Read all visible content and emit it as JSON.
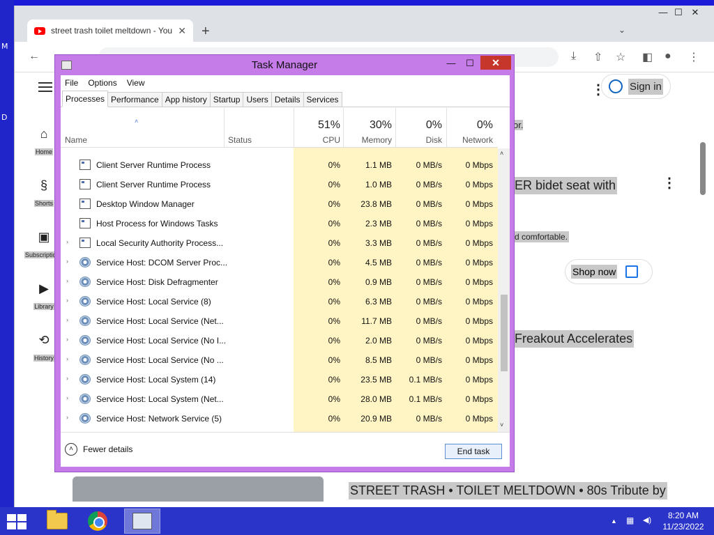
{
  "desktop": {
    "letters": [
      "M",
      "D"
    ]
  },
  "browser": {
    "tab_title": "street trash toilet meltdown - You",
    "tab_close": "✕",
    "new_tab": "+",
    "tab_chevron": "⌄",
    "window_min": "—",
    "window_max": "☐",
    "window_close": "✕",
    "back_icon": "←",
    "download_icon": "⤓",
    "share_icon": "⇧",
    "star_icon": "☆",
    "sidepanel_icon": "◧",
    "profile_icon": "●",
    "more_icon": "⋮"
  },
  "youtube": {
    "nav": [
      {
        "label": "Home",
        "icon": "⌂"
      },
      {
        "label": "Shorts",
        "icon": "§"
      },
      {
        "label": "Subscriptions",
        "icon": "▣"
      },
      {
        "label": "Library",
        "icon": "▶"
      },
      {
        "label": "History",
        "icon": "⟲"
      }
    ],
    "sign_in": "Sign in",
    "header_more": "⋮",
    "ad_text_1": "or.",
    "ad_title": "ER bidet seat with",
    "ad_more": "⋮",
    "ad_desc": "d comfortable.",
    "shop_now": "Shop now",
    "video_title_1": "Freakout Accelerates",
    "video_title_2": "STREET TRASH • TOILET MELTDOWN • 80s Tribute by"
  },
  "task_manager": {
    "title": "Task Manager",
    "minimize": "—",
    "maximize": "☐",
    "close": "✕",
    "menu": [
      "File",
      "Options",
      "View"
    ],
    "tabs": [
      "Processes",
      "Performance",
      "App history",
      "Startup",
      "Users",
      "Details",
      "Services"
    ],
    "active_tab": "Processes",
    "columns": {
      "name": "Name",
      "status": "Status",
      "cpu_pct": "51%",
      "cpu": "CPU",
      "mem_pct": "30%",
      "mem": "Memory",
      "disk_pct": "0%",
      "disk": "Disk",
      "net_pct": "0%",
      "net": "Network"
    },
    "sort_indicator": "˄",
    "processes": [
      {
        "name": "Client Server Runtime Process",
        "cpu": "0%",
        "mem": "1.1 MB",
        "disk": "0 MB/s",
        "net": "0 Mbps",
        "expandable": false,
        "icon": "app"
      },
      {
        "name": "Client Server Runtime Process",
        "cpu": "0%",
        "mem": "1.0 MB",
        "disk": "0 MB/s",
        "net": "0 Mbps",
        "expandable": false,
        "icon": "app"
      },
      {
        "name": "Desktop Window Manager",
        "cpu": "0%",
        "mem": "23.8 MB",
        "disk": "0 MB/s",
        "net": "0 Mbps",
        "expandable": false,
        "icon": "app"
      },
      {
        "name": "Host Process for Windows Tasks",
        "cpu": "0%",
        "mem": "2.3 MB",
        "disk": "0 MB/s",
        "net": "0 Mbps",
        "expandable": false,
        "icon": "app"
      },
      {
        "name": "Local Security Authority Process...",
        "cpu": "0%",
        "mem": "3.3 MB",
        "disk": "0 MB/s",
        "net": "0 Mbps",
        "expandable": true,
        "icon": "app"
      },
      {
        "name": "Service Host: DCOM Server Proc...",
        "cpu": "0%",
        "mem": "4.5 MB",
        "disk": "0 MB/s",
        "net": "0 Mbps",
        "expandable": true,
        "icon": "gear"
      },
      {
        "name": "Service Host: Disk Defragmenter",
        "cpu": "0%",
        "mem": "0.9 MB",
        "disk": "0 MB/s",
        "net": "0 Mbps",
        "expandable": true,
        "icon": "gear"
      },
      {
        "name": "Service Host: Local Service (8)",
        "cpu": "0%",
        "mem": "6.3 MB",
        "disk": "0 MB/s",
        "net": "0 Mbps",
        "expandable": true,
        "icon": "gear"
      },
      {
        "name": "Service Host: Local Service (Net...",
        "cpu": "0%",
        "mem": "11.7 MB",
        "disk": "0 MB/s",
        "net": "0 Mbps",
        "expandable": true,
        "icon": "gear"
      },
      {
        "name": "Service Host: Local Service (No I...",
        "cpu": "0%",
        "mem": "2.0 MB",
        "disk": "0 MB/s",
        "net": "0 Mbps",
        "expandable": true,
        "icon": "gear"
      },
      {
        "name": "Service Host: Local Service (No ...",
        "cpu": "0%",
        "mem": "8.5 MB",
        "disk": "0 MB/s",
        "net": "0 Mbps",
        "expandable": true,
        "icon": "gear"
      },
      {
        "name": "Service Host: Local System (14)",
        "cpu": "0%",
        "mem": "23.5 MB",
        "disk": "0.1 MB/s",
        "net": "0 Mbps",
        "expandable": true,
        "icon": "gear"
      },
      {
        "name": "Service Host: Local System (Net...",
        "cpu": "0%",
        "mem": "28.0 MB",
        "disk": "0.1 MB/s",
        "net": "0 Mbps",
        "expandable": true,
        "icon": "gear"
      },
      {
        "name": "Service Host: Network Service (5)",
        "cpu": "0%",
        "mem": "20.9 MB",
        "disk": "0 MB/s",
        "net": "0 Mbps",
        "expandable": true,
        "icon": "gear"
      }
    ],
    "expand_glyph": "›",
    "fewer_details": "Fewer details",
    "fewer_icon": "˄",
    "end_task": "End task",
    "scroll_up": "˄",
    "scroll_down": "˅"
  },
  "taskbar": {
    "clock_time": "8:20 AM",
    "clock_date": "11/23/2022",
    "tray_up": "▲",
    "tray_network": "▦",
    "tray_volume": "◀)"
  },
  "colors": {
    "desktop": "#1c1cd8",
    "task_manager_frame": "#c57be8",
    "highlight_column": "#fff4c4",
    "close_red": "#c7362b",
    "taskbar": "#2a34c8"
  }
}
